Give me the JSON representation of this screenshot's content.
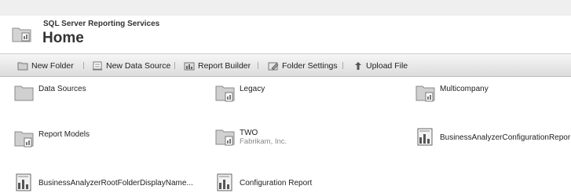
{
  "header": {
    "subtitle": "SQL Server Reporting Services",
    "title": "Home"
  },
  "toolbar": {
    "items": [
      {
        "label": "New Folder",
        "icon": "new-folder-icon"
      },
      {
        "label": "New Data Source",
        "icon": "new-data-source-icon"
      },
      {
        "label": "Report Builder",
        "icon": "report-builder-icon"
      },
      {
        "label": "Folder Settings",
        "icon": "folder-settings-icon"
      },
      {
        "label": "Upload File",
        "icon": "upload-file-icon"
      }
    ]
  },
  "items": [
    {
      "label": "Data Sources",
      "type": "folder",
      "icon": "folder-icon"
    },
    {
      "label": "Legacy",
      "type": "folder",
      "icon": "folder-icon"
    },
    {
      "label": "Multicompany",
      "type": "folder",
      "icon": "folder-icon"
    },
    {
      "label": "Report Models",
      "type": "folder",
      "icon": "folder-icon"
    },
    {
      "label": "TWO",
      "description": "Fabrikam, Inc.",
      "type": "folder",
      "icon": "folder-icon"
    },
    {
      "label": "BusinessAnalyzerConfigurationRepor",
      "type": "report",
      "icon": "report-icon"
    },
    {
      "label": "BusinessAnalyzerRootFolderDisplayName...",
      "type": "report",
      "icon": "report-icon"
    },
    {
      "label": "Configuration Report",
      "type": "report",
      "icon": "report-icon"
    }
  ]
}
